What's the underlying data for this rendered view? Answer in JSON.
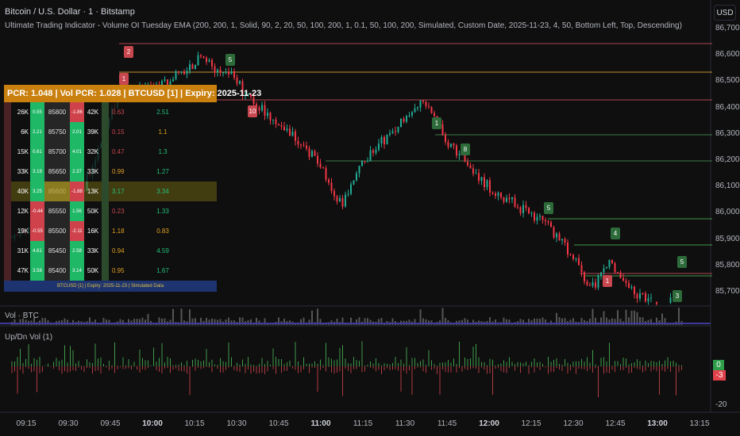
{
  "header": {
    "title": "Bitcoin / U.S. Dollar · 1 · Bitstamp",
    "indicator": "Ultimate Trading Indicator - Volume OI Tuesday EMA (200, 200, 1, Solid, 90, 2, 20, 50, 100, 200, 1, 0.1, 50, 100, 200, Simulated, Custom Date, 2025-11-23, 4, 50, Bottom Left, Top, Descending)"
  },
  "currency": "USD",
  "price_axis": [
    "86,700",
    "86,600",
    "86,500",
    "86,400",
    "86,300",
    "86,200",
    "86,100",
    "86,000",
    "85,900",
    "85,800",
    "85,700"
  ],
  "time_axis": [
    "09:15",
    "09:30",
    "09:45",
    "10:00",
    "10:15",
    "10:30",
    "10:45",
    "11:00",
    "11:15",
    "11:30",
    "11:45",
    "12:00",
    "12:15",
    "12:30",
    "12:45",
    "13:00",
    "13:15"
  ],
  "panes": {
    "volume": "Vol · BTC",
    "updown": "Up/Dn Vol (1)",
    "updown_axis": "-20",
    "updown_up": "0",
    "updown_down": "-3"
  },
  "markers": [
    {
      "label": "2",
      "color": "red"
    },
    {
      "label": "1",
      "color": "red"
    },
    {
      "label": "5",
      "color": "green"
    },
    {
      "label": "10",
      "color": "red"
    },
    {
      "label": "1",
      "color": "green"
    },
    {
      "label": "8",
      "color": "green"
    },
    {
      "label": "5",
      "color": "green"
    },
    {
      "label": "4",
      "color": "green"
    },
    {
      "label": "5",
      "color": "green"
    },
    {
      "label": "1",
      "color": "red"
    },
    {
      "label": "3",
      "color": "green"
    }
  ],
  "table": {
    "header": "PCR: 1.048 | Vol PCR: 1.028 | BTCUSD [1] | Expiry: 2025-11-23",
    "footer": "BTCUSD [1] | Expiry: 2025-11-23 | Simulated Data",
    "rows": [
      {
        "call_oi": "26K",
        "call_chg": "0.55",
        "strike": "85800",
        "put_chg": "-1.86",
        "put_oi": "42K",
        "pcr": "0.63",
        "vol_pcr": "2.51",
        "pcr_color": "#c9474f",
        "vol_color": "#22c07a"
      },
      {
        "call_oi": "6K",
        "call_chg": "2.21",
        "strike": "85750",
        "put_chg": "2.01",
        "put_oi": "39K",
        "pcr": "0.15",
        "vol_pcr": "1.1",
        "pcr_color": "#c9474f",
        "vol_color": "#e0a020"
      },
      {
        "call_oi": "15K",
        "call_chg": "0.61",
        "strike": "85700",
        "put_chg": "4.01",
        "put_oi": "32K",
        "pcr": "0.47",
        "vol_pcr": "1.3",
        "pcr_color": "#c9474f",
        "vol_color": "#22c07a"
      },
      {
        "call_oi": "33K",
        "call_chg": "3.19",
        "strike": "85650",
        "put_chg": "2.37",
        "put_oi": "33K",
        "pcr": "0.99",
        "vol_pcr": "1.27",
        "pcr_color": "#e0a020",
        "vol_color": "#22c07a"
      },
      {
        "call_oi": "40K",
        "call_chg": "3.25",
        "strike": "85600",
        "put_chg": "-1.88",
        "put_oi": "13K",
        "pcr": "3.17",
        "vol_pcr": "3.34",
        "pcr_color": "#22c07a",
        "vol_color": "#22c07a"
      },
      {
        "call_oi": "12K",
        "call_chg": "-0.44",
        "strike": "85550",
        "put_chg": "1.56",
        "put_oi": "50K",
        "pcr": "0.23",
        "vol_pcr": "1.33",
        "pcr_color": "#c9474f",
        "vol_color": "#22c07a"
      },
      {
        "call_oi": "19K",
        "call_chg": "-0.55",
        "strike": "85500",
        "put_chg": "-2.11",
        "put_oi": "16K",
        "pcr": "1.18",
        "vol_pcr": "0.83",
        "pcr_color": "#e0a020",
        "vol_color": "#e0a020"
      },
      {
        "call_oi": "31K",
        "call_chg": "4.61",
        "strike": "85450",
        "put_chg": "2.58",
        "put_oi": "33K",
        "pcr": "0.94",
        "vol_pcr": "4.59",
        "pcr_color": "#e0a020",
        "vol_color": "#22c07a"
      },
      {
        "call_oi": "47K",
        "call_chg": "3.58",
        "strike": "85400",
        "put_chg": "3.14",
        "put_oi": "50K",
        "pcr": "0.95",
        "vol_pcr": "1.67",
        "pcr_color": "#e0a020",
        "vol_color": "#22c07a"
      }
    ]
  },
  "colors": {
    "up": "#22ab94",
    "down": "#f23645",
    "positive": "#1fb866",
    "negative": "#d0424b",
    "header": "#c9800f",
    "footer": "#1e3470"
  }
}
